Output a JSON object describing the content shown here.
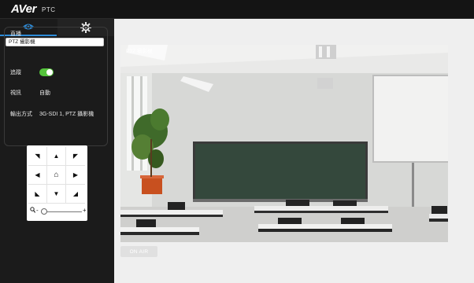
{
  "app": {
    "logo": "AVer",
    "product": "PTC"
  },
  "tabs": [
    {
      "label": "",
      "icon": "eye-icon",
      "active": true
    },
    {
      "label": "",
      "icon": "gear-icon",
      "active": false
    }
  ],
  "live_panel": {
    "source_label": "直播",
    "source_value": "PTZ 攝影機",
    "tracking_label": "追蹤",
    "tracking_on": true,
    "view_label": "視訊",
    "view_value": "自動",
    "output_label": "輸出方式",
    "output_value": "3G-SDI 1, PTZ 攝影機"
  },
  "ptz": {
    "arrows": [
      "◥",
      "▲",
      "◤",
      "◀",
      "⌂",
      "▶",
      "◣",
      "▼",
      "◢"
    ],
    "zoom_icon": "🔍",
    "zoom_minus": "-",
    "zoom_plus": "+",
    "zoom_level": 0.0
  },
  "video": {
    "camera_label": "PTZ 攝影機"
  },
  "onair": {
    "label": "ON AIR"
  },
  "colors": {
    "accent": "#2d8bd8",
    "toggle_on": "#54c33b",
    "sidebar": "#1b1b1b",
    "topbar": "#141414"
  }
}
